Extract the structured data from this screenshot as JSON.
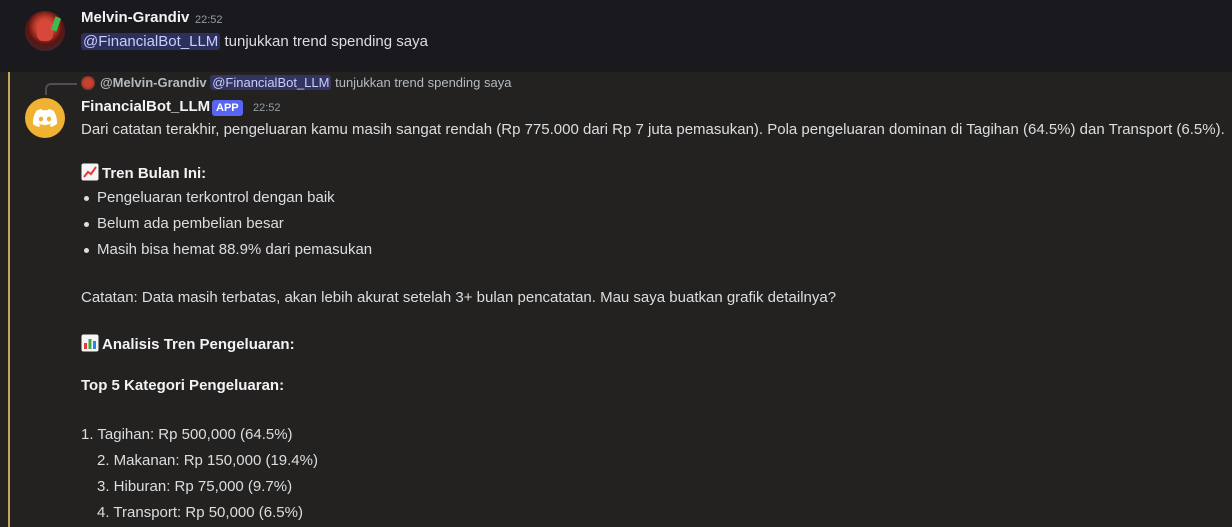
{
  "message1": {
    "username": "Melvin-Grandiv",
    "timestamp": "22:52",
    "mention": "@FinancialBot_LLM",
    "text": " tunjukkan trend spending saya"
  },
  "reply": {
    "username": "@Melvin-Grandiv",
    "mention": "@FinancialBot_LLM",
    "text": "tunjukkan trend spending saya"
  },
  "message2": {
    "username": "FinancialBot_LLM",
    "badge": "APP",
    "timestamp": "22:52",
    "intro": "Dari catatan terakhir, pengeluaran kamu masih sangat rendah (Rp 775.000 dari Rp 7 juta pemasukan). Pola pengeluaran dominan di Tagihan (64.5%) dan Transport (6.5%).",
    "trend_heading": "Tren Bulan Ini:",
    "bullets": [
      "Pengeluaran terkontrol dengan baik",
      "Belum ada pembelian besar",
      "Masih bisa hemat 88.9% dari pemasukan"
    ],
    "note": "Catatan: Data masih terbatas, akan lebih akurat setelah 3+ bulan pencatatan. Mau saya buatkan grafik detailnya?",
    "analysis_heading": "Analisis Tren Pengeluaran:",
    "top5_heading": "Top 5 Kategori Pengeluaran:",
    "categories": [
      "1. Tagihan: Rp 500,000 (64.5%)",
      "2. Makanan: Rp 150,000 (19.4%)",
      "3. Hiburan: Rp 75,000 (9.7%)",
      "4. Transport: Rp 50,000 (6.5%)"
    ]
  },
  "colors": {
    "accent_bar": "#c3a85f",
    "app_badge": "#5865f2",
    "bot_avatar": "#f0b232",
    "mention_bg": "#3c4270"
  },
  "icons": {
    "trend": "chart-increasing-icon",
    "analysis": "bar-chart-icon",
    "bot_avatar": "discord-logo-icon"
  }
}
